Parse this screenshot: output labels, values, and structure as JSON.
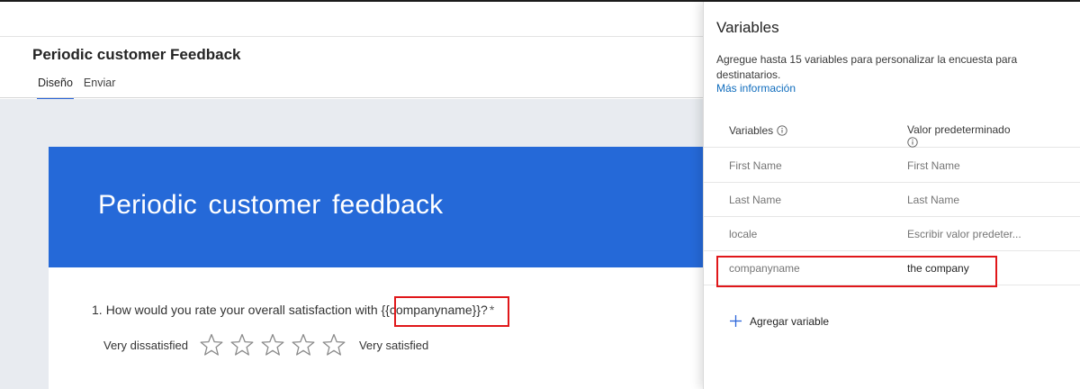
{
  "header": {
    "title": "Periodic customer Feedback",
    "tabs": [
      {
        "label": "Diseño",
        "active": true
      },
      {
        "label": "Enviar",
        "active": false
      }
    ]
  },
  "survey": {
    "banner_title": "Periodic customer feedback",
    "banner_color": "#2569d8",
    "question": {
      "number": "1.",
      "text": "How would you rate your overall satisfaction with",
      "placeholder": "{{companyname}}",
      "suffix": "?",
      "required_mark": "*"
    },
    "rating": {
      "left_label": "Very dissatisfied",
      "right_label": "Very satisfied",
      "star_count": 5,
      "selected": 0
    }
  },
  "panel": {
    "title": "Variables",
    "description": "Agregue hasta 15 variables para personalizar la encuesta para destinatarios.",
    "link": "Más información",
    "columns": {
      "variables": "Variables",
      "default_value": "Valor predeterminado"
    },
    "rows": [
      {
        "name": "First Name",
        "value": "First Name"
      },
      {
        "name": "Last Name",
        "value": "Last Name"
      },
      {
        "name": "locale",
        "value": "Escribir valor predeter..."
      },
      {
        "name": "companyname",
        "value": "the company"
      }
    ],
    "add_label": "Agregar variable"
  },
  "colors": {
    "accent": "#2b65d9",
    "highlight": "#e0171a",
    "link": "#0f6cbd"
  }
}
